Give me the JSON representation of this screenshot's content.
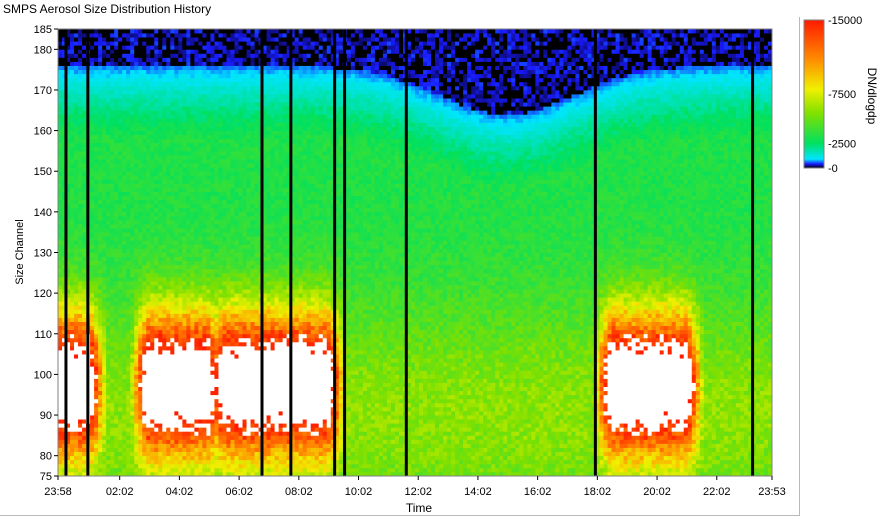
{
  "window": {
    "title": "SMPS Aerosol Size Distribution History"
  },
  "chart_data": {
    "type": "heatmap",
    "title": "SMPS Aerosol Size Distribution History",
    "xlabel": "Time",
    "ylabel": "Size Channel",
    "x_ticks": [
      "23:58",
      "02:02",
      "04:02",
      "06:02",
      "08:02",
      "10:02",
      "12:02",
      "14:02",
      "16:02",
      "18:02",
      "20:02",
      "22:02",
      "23:53"
    ],
    "y_ticks": [
      75,
      80,
      90,
      100,
      110,
      120,
      130,
      140,
      150,
      160,
      170,
      180,
      185
    ],
    "ylim": [
      75,
      185
    ],
    "colorbar": {
      "label": "DN/dlogdp",
      "ticks": [
        15000,
        7500,
        2500,
        0
      ],
      "tick_labels": [
        "-15000",
        "-7500",
        "-2500",
        "-0"
      ],
      "range": [
        0,
        15000
      ],
      "stops": [
        {
          "v": 0,
          "c": "#000000"
        },
        {
          "v": 400,
          "c": "#1a1aff"
        },
        {
          "v": 900,
          "c": "#00e5ff"
        },
        {
          "v": 2500,
          "c": "#00e060"
        },
        {
          "v": 5500,
          "c": "#7fe000"
        },
        {
          "v": 8000,
          "c": "#f0f000"
        },
        {
          "v": 11000,
          "c": "#ff8c00"
        },
        {
          "v": 15000,
          "c": "#ff1a00"
        }
      ],
      "overflow_color": "#ffffff"
    },
    "gap_times": [
      "00:14",
      "00:58",
      "06:48",
      "07:46",
      "09:14",
      "09:34",
      "11:38",
      "17:58",
      "23:14"
    ],
    "high_concentration_periods": [
      {
        "start": "00:00",
        "end": "01:00",
        "peak_channel": 100
      },
      {
        "start": "03:00",
        "end": "05:00",
        "peak_channel": 100
      },
      {
        "start": "05:30",
        "end": "09:00",
        "peak_channel": 97
      },
      {
        "start": "18:30",
        "end": "21:00",
        "peak_channel": 97
      }
    ],
    "grid": false
  }
}
